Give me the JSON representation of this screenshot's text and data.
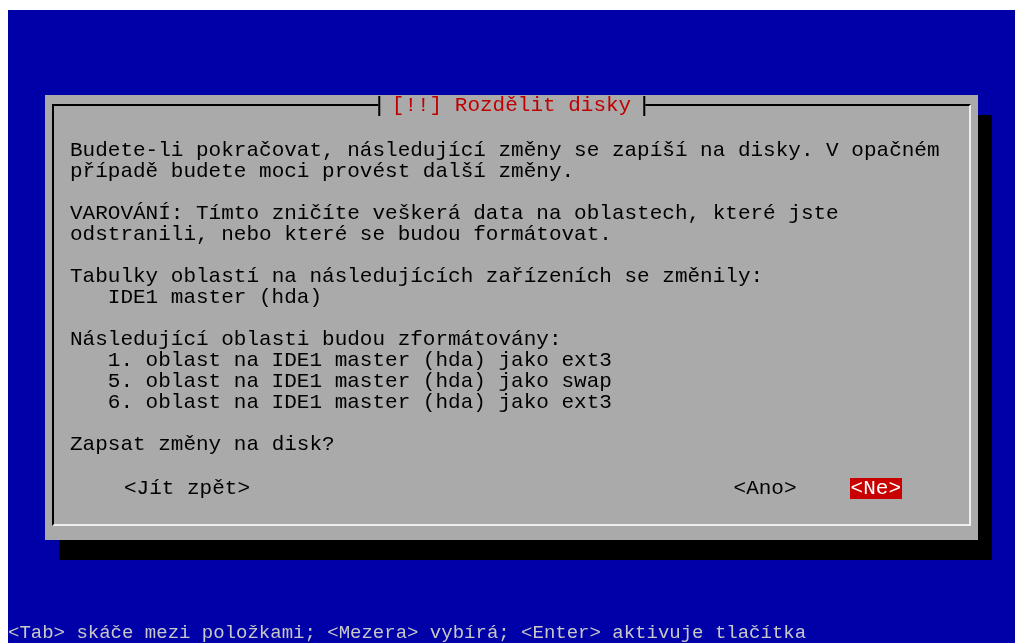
{
  "dialog": {
    "title": "[!!] Rozdělit disky",
    "sections": [
      {
        "text": "Budete-li pokračovat, následující změny se zapíší na disky. V opačném případě budete moci provést další změny."
      },
      {
        "text": "VAROVÁNÍ: Tímto zničíte veškerá data na oblastech, které jste odstranili, nebo které se budou formátovat."
      },
      {
        "text": "Tabulky oblastí na následujících zařízeních se změnily:",
        "items": [
          "IDE1 master (hda)"
        ]
      },
      {
        "text": "Následující oblasti budou zformátovány:",
        "items": [
          "1. oblast na IDE1 master (hda) jako ext3",
          "5. oblast na IDE1 master (hda) jako swap",
          "6. oblast na IDE1 master (hda) jako ext3"
        ]
      },
      {
        "text": "Zapsat změny na disk?"
      }
    ],
    "buttons": [
      {
        "label": "<Jít zpět>",
        "selected": false
      },
      {
        "label": "<Ano>",
        "selected": false
      },
      {
        "label": "<Ne>",
        "selected": true
      }
    ]
  },
  "status_bar": "<Tab> skáče mezi položkami; <Mezera> vybírá; <Enter> aktivuje tlačítka"
}
